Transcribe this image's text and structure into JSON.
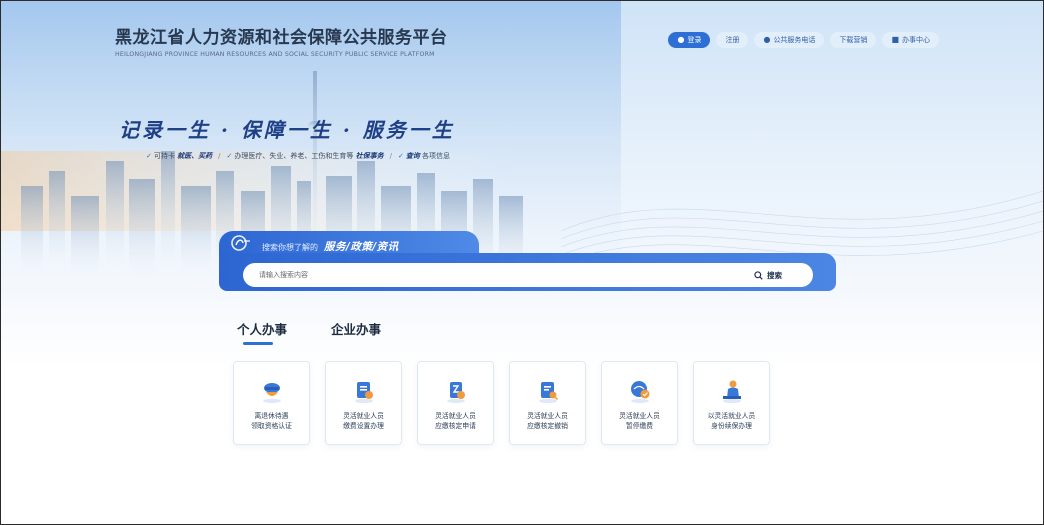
{
  "header": {
    "title_cn": "黑龙江省人力资源和社会保障公共服务平台",
    "title_en": "HEILONGJIANG PROVINCE HUMAN RESOURCES AND SOCIAL SECURITY PUBLIC SERVICE PLATFORM",
    "nav": [
      {
        "label": "登录",
        "icon": "user-icon"
      },
      {
        "label": "注册"
      },
      {
        "label": "公共服务电话",
        "icon": "user-icon"
      },
      {
        "label": "下载营销"
      },
      {
        "label": "办事中心",
        "icon": "bank-icon"
      }
    ]
  },
  "hero": {
    "slogan": "记录一生 · 保障一生 · 服务一生",
    "features": [
      {
        "prefix": "可持卡 ",
        "emph": "就医、买药",
        "suffix": ""
      },
      {
        "prefix": "办理医疗、失业、养老、工伤和生育等 ",
        "emph": "社保事务",
        "suffix": ""
      },
      {
        "prefix": "",
        "emph": "查询",
        "suffix": " 各项信息"
      }
    ]
  },
  "search": {
    "hint_prefix": "搜索你想了解的",
    "hint_emph": "服务/政策/资讯",
    "placeholder": "请输入搜索内容",
    "button_label": "搜索"
  },
  "tabs": [
    {
      "label": "个人办事",
      "active": true
    },
    {
      "label": "企业办事",
      "active": false
    }
  ],
  "services": [
    {
      "line1": "离退休待遇",
      "line2": "领取资格认证",
      "icon": "retiree-icon"
    },
    {
      "line1": "灵活就业人员",
      "line2": "缴费设置办理",
      "icon": "document-coin-icon"
    },
    {
      "line1": "灵活就业人员",
      "line2": "应缴核定申请",
      "icon": "document-coin-icon"
    },
    {
      "line1": "灵活就业人员",
      "line2": "应缴核定撤销",
      "icon": "document-search-icon"
    },
    {
      "line1": "灵活就业人员",
      "line2": "暂停缴费",
      "icon": "person-check-icon"
    },
    {
      "line1": "以灵活就业人员",
      "line2": "身份续保办理",
      "icon": "person-desk-icon"
    }
  ],
  "colors": {
    "accent": "#2e6fd6",
    "title": "#27384f",
    "slogan": "#1f3f86"
  }
}
